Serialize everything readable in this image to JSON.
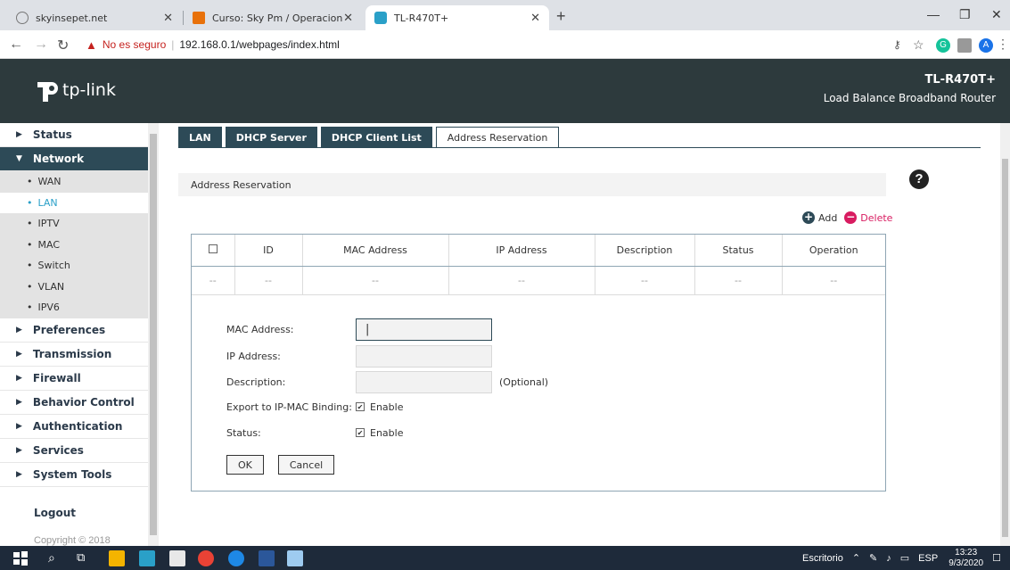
{
  "browser": {
    "tabs": [
      {
        "title": "skyinsepet.net",
        "active": false
      },
      {
        "title": "Curso: Sky Pm / Operacion",
        "active": false
      },
      {
        "title": "TL-R470T+",
        "active": true
      }
    ],
    "security_label": "No es seguro",
    "url": "192.168.0.1/webpages/index.html",
    "profile_initial": "A"
  },
  "header": {
    "logo_text": "tp-link",
    "model": "TL-R470T+",
    "product": "Load Balance Broadband Router"
  },
  "sidebar": {
    "items": [
      {
        "label": "Status",
        "open": false
      },
      {
        "label": "Network",
        "open": true
      },
      {
        "label": "Preferences",
        "open": false
      },
      {
        "label": "Transmission",
        "open": false
      },
      {
        "label": "Firewall",
        "open": false
      },
      {
        "label": "Behavior Control",
        "open": false
      },
      {
        "label": "Authentication",
        "open": false
      },
      {
        "label": "Services",
        "open": false
      },
      {
        "label": "System Tools",
        "open": false
      }
    ],
    "network_sub": [
      "WAN",
      "LAN",
      "IPTV",
      "MAC",
      "Switch",
      "VLAN",
      "IPV6"
    ],
    "selected_sub": "LAN",
    "logout": "Logout",
    "copyright": "Copyright © 2018"
  },
  "tabs": [
    "LAN",
    "DHCP Server",
    "DHCP Client List",
    "Address Reservation"
  ],
  "active_tab": "Address Reservation",
  "section_title": "Address Reservation",
  "actions": {
    "add": "Add",
    "delete": "Delete"
  },
  "table": {
    "columns": [
      "ID",
      "MAC Address",
      "IP Address",
      "Description",
      "Status",
      "Operation"
    ],
    "empty_row": [
      "--",
      "--",
      "--",
      "--",
      "--",
      "--",
      "--"
    ]
  },
  "form": {
    "mac_label": "MAC Address:",
    "mac_value": "",
    "ip_label": "IP Address:",
    "ip_value": "",
    "desc_label": "Description:",
    "desc_value": "",
    "optional": "(Optional)",
    "export_label": "Export to IP-MAC Binding:",
    "export_check": "Enable",
    "status_label": "Status:",
    "status_check": "Enable",
    "ok": "OK",
    "cancel": "Cancel"
  },
  "taskbar": {
    "desktop": "Escritorio",
    "lang": "ESP",
    "time": "13:23",
    "date": "9/3/2020"
  },
  "colors": {
    "header_bg": "#2d3a3d",
    "nav_active": "#2d4a57",
    "accent": "#2aa0c8",
    "delete": "#d81b60"
  }
}
